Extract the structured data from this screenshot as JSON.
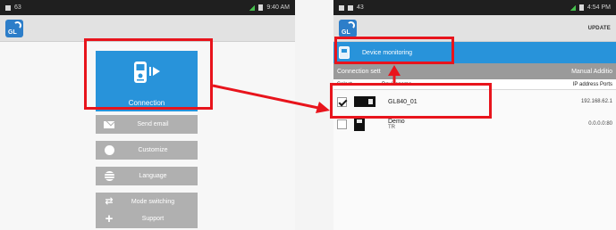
{
  "accent_color": "#2893da",
  "annotation_color": "#e8141c",
  "left_screen": {
    "status": {
      "left_text": "63",
      "right_text": "9:40 AM"
    },
    "connection_tile": {
      "label": "Connection",
      "icon": "device-signal-icon"
    },
    "menu_items": [
      {
        "label": "Send email",
        "icon": "mail-icon"
      },
      {
        "label": "Customize",
        "icon": "gear-icon"
      },
      {
        "label": "Language",
        "icon": "globe-icon"
      },
      {
        "label": "Mode switching",
        "icon": "swap-icon"
      },
      {
        "label": "Support",
        "icon": "plus-icon"
      }
    ]
  },
  "right_screen": {
    "status": {
      "left_text": "43",
      "right_text": "4:54 PM"
    },
    "update_label": "UPDATE",
    "device_monitoring": {
      "label": "Device monitoring",
      "icon": "device-icon"
    },
    "connection_bar": {
      "left": "Connection sett",
      "right": "Manual Additio"
    },
    "table_headers": {
      "select": "Select",
      "device_name": "Devicename",
      "ip": "IP address Ports"
    },
    "devices": [
      {
        "name": "GL840_01",
        "sub": "",
        "ip": "192.168.62.1",
        "checked": true
      },
      {
        "name": "Demo",
        "sub": "TR",
        "ip": "0.0.0.0:80",
        "checked": false
      }
    ]
  }
}
